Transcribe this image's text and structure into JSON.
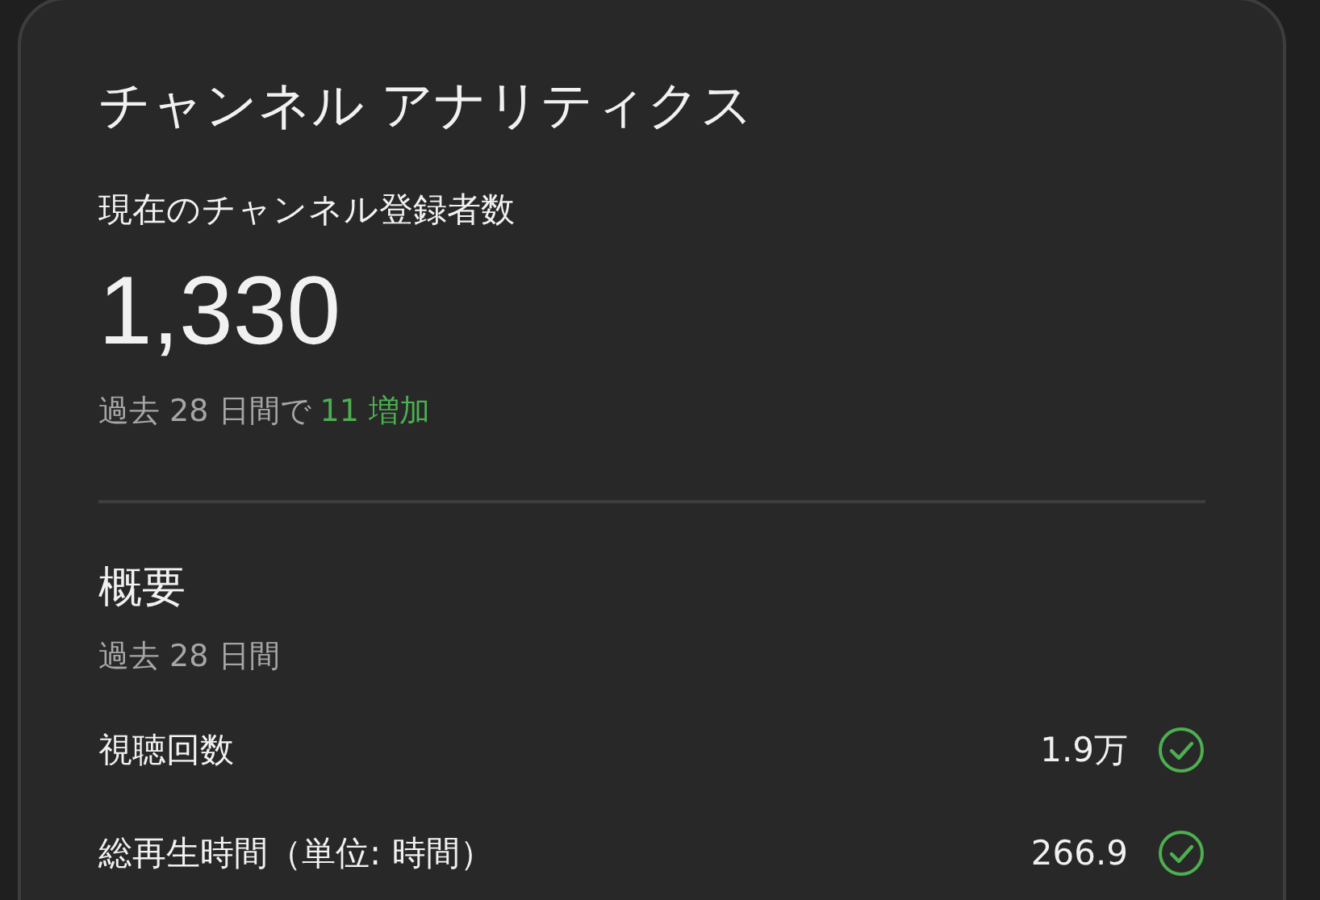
{
  "card": {
    "title": "チャンネル アナリティクス",
    "subscribers": {
      "label": "現在のチャンネル登録者数",
      "value": "1,330",
      "period": "過去 28 日間で",
      "change": "11 増加"
    },
    "summary": {
      "heading": "概要",
      "period": "過去 28 日間",
      "metrics": [
        {
          "label": "視聴回数",
          "value": "1.9万",
          "checked": true
        },
        {
          "label": "総再生時間（単位: 時間）",
          "value": "266.9",
          "checked": true
        }
      ]
    }
  }
}
